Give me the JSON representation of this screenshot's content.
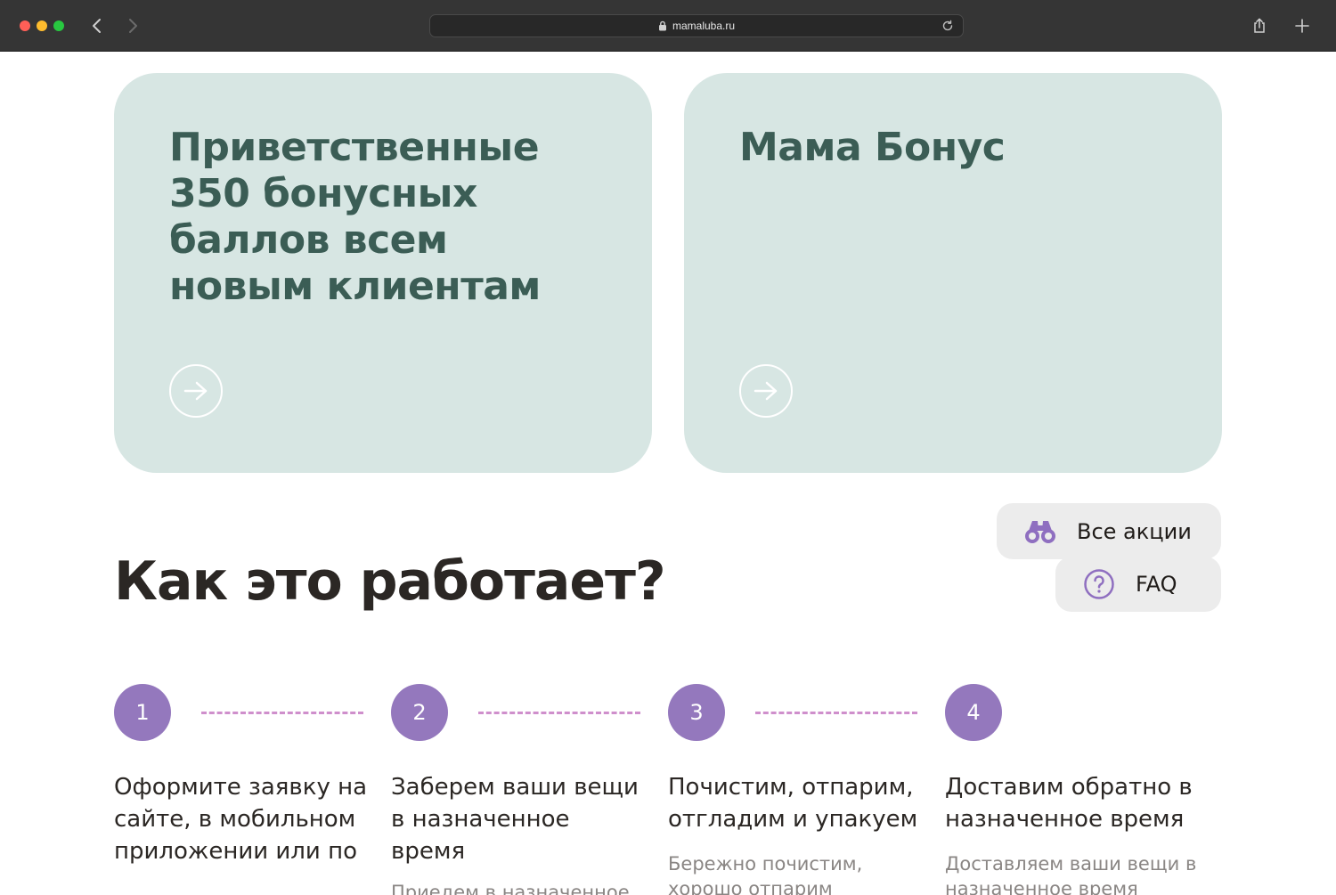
{
  "browser": {
    "url": "mamaluba.ru"
  },
  "promos": [
    {
      "title": "Приветственные 350 бонусных баллов всем новым клиентам"
    },
    {
      "title": "Мама Бонус"
    }
  ],
  "how_it_works": {
    "title": "Как это работает?",
    "steps": [
      {
        "number": "1",
        "title": "Оформите заявку на сайте, в мобильном приложении или по",
        "description": ""
      },
      {
        "number": "2",
        "title": "Заберем ваши вещи в назначенное время",
        "description": "Приедем в назначенное"
      },
      {
        "number": "3",
        "title": "Почистим, отпарим, отгладим и упакуем",
        "description": "Бережно почистим, хорошо отпарим"
      },
      {
        "number": "4",
        "title": "Доставим обратно в назначенное время",
        "description": "Доставляем ваши вещи в назначенное время"
      }
    ]
  },
  "floating": {
    "all_actions": "Все акции",
    "faq": "FAQ"
  },
  "colors": {
    "card_bg": "#d7e6e3",
    "card_title": "#3b5d55",
    "step_circle": "#9478bd",
    "step_dash": "#cf8fcc",
    "icon_purple": "#8f6fc0"
  }
}
